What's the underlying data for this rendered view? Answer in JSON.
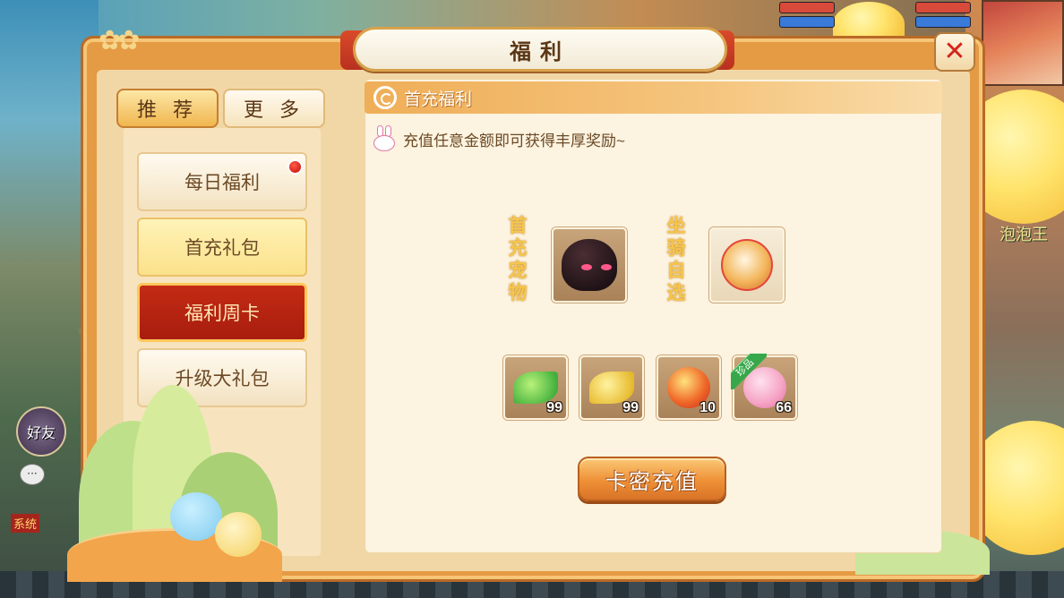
{
  "window": {
    "title": "福利"
  },
  "tabs": [
    {
      "label": "推 荐",
      "active": true
    },
    {
      "label": "更 多",
      "active": false
    }
  ],
  "menu": [
    {
      "label": "每日福利",
      "state": "normal",
      "badge": true
    },
    {
      "label": "首充礼包",
      "state": "highlight",
      "badge": false
    },
    {
      "label": "福利周卡",
      "state": "selected",
      "badge": false
    },
    {
      "label": "升级大礼包",
      "state": "normal",
      "badge": false
    }
  ],
  "content": {
    "section_title": "首充福利",
    "notice": "充值任意金额即可获得丰厚奖励~",
    "pet_label": [
      "首",
      "充",
      "宠",
      "物"
    ],
    "mount_label": [
      "坐",
      "骑",
      "自",
      "选"
    ],
    "reward_items": [
      {
        "icon": "green-leaf-icon",
        "count": "99",
        "rare": false
      },
      {
        "icon": "gold-leaf-icon",
        "count": "99",
        "rare": false
      },
      {
        "icon": "red-fruit-icon",
        "count": "10",
        "rare": false
      },
      {
        "icon": "pink-pig-icon",
        "count": "66",
        "rare": true,
        "rare_label": "珍品"
      }
    ],
    "recharge_button": "卡密充值"
  },
  "hud": {
    "friend_label": "好友",
    "chat_icon": "···",
    "system_tag": "系统",
    "map_label": "泡泡王"
  },
  "colors": {
    "accent_red": "#c32b14",
    "panel_orange": "#e59a44",
    "gold_text": "#f6c64b",
    "title_brown": "#5b3716"
  }
}
